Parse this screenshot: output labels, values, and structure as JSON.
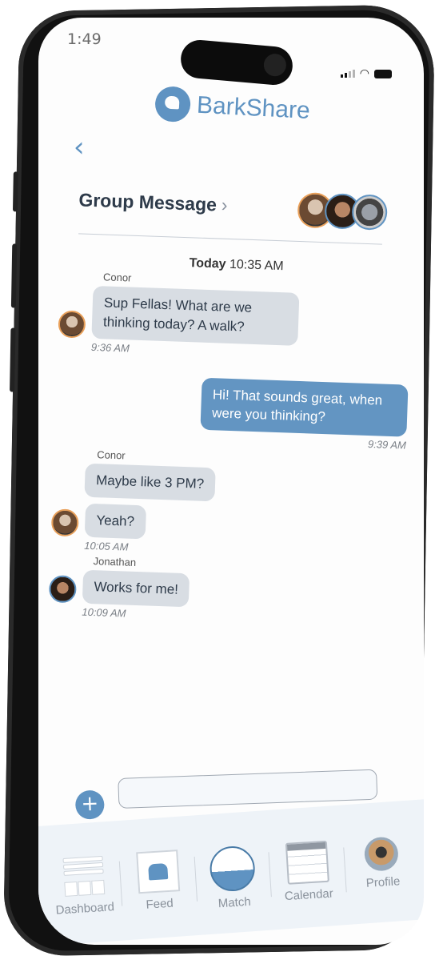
{
  "status_bar": {
    "time": "1:49"
  },
  "app": {
    "name": "BarkShare"
  },
  "header": {
    "title": "Group Message",
    "chevron": "›",
    "back": "‹",
    "participants": [
      "Conor",
      "Jonathan",
      "Dog"
    ]
  },
  "chat": {
    "day_label": "Today",
    "day_time": "10:35 AM",
    "messages": [
      {
        "sender": "Conor",
        "text": "Sup Fellas! What are we thinking today? A walk?",
        "time": "9:36 AM",
        "direction": "in"
      },
      {
        "sender": "",
        "text": "Hi! That sounds great, when were you thinking?",
        "time": "9:39 AM",
        "direction": "out"
      },
      {
        "sender": "Conor",
        "text": "Maybe like 3 PM?",
        "time": "",
        "direction": "in"
      },
      {
        "sender": "",
        "text": "Yeah?",
        "time": "10:05 AM",
        "direction": "in"
      },
      {
        "sender": "Jonathan",
        "text": "Works for me!",
        "time": "10:09 AM",
        "direction": "in"
      }
    ]
  },
  "composer": {
    "add_icon": "+",
    "input_value": "",
    "input_placeholder": ""
  },
  "tabs": [
    {
      "label": "Dashboard",
      "icon": "dashboard-icon"
    },
    {
      "label": "Feed",
      "icon": "feed-icon"
    },
    {
      "label": "Match",
      "icon": "match-icon",
      "active": true
    },
    {
      "label": "Calendar",
      "icon": "calendar-icon"
    },
    {
      "label": "Profile",
      "icon": "profile-avatar"
    }
  ],
  "colors": {
    "accent": "#5f93c2",
    "incoming_bubble": "#d8dde3",
    "outgoing_bubble": "#6395c2",
    "conor_ring": "#e9a05a"
  }
}
